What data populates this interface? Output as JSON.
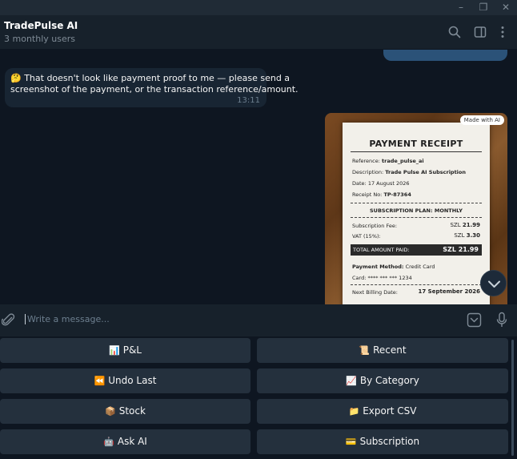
{
  "window": {
    "min_icon": "minimize-icon",
    "max_icon": "restore-icon",
    "close_icon": "close-icon"
  },
  "header": {
    "title": "TradePulse AI",
    "subtitle": "3 monthly users",
    "icons": [
      "search-icon",
      "sidebar-toggle-icon",
      "more-vert-icon"
    ]
  },
  "messages": {
    "incoming": {
      "emoji": "🤔",
      "line1": "That doesn't look like payment proof to me — please send a",
      "line2": "screenshot of the payment, or the transaction reference/amount.",
      "time": "13:11"
    },
    "image": {
      "badge": "Made with AI",
      "receipt": {
        "title": "PAYMENT RECEIPT",
        "reference_label": "Reference:",
        "reference": "trade_pulse_ai",
        "description_label": "Description:",
        "description": "Trade Pulse AI Subscription",
        "date_label": "Date:",
        "date": "17 August 2026",
        "receipt_no_label": "Receipt No:",
        "receipt_no": "TP-87364",
        "plan": "SUBSCRIPTION PLAN: MONTHLY",
        "fee_label": "Subscription Fee:",
        "fee_currency": "SZL",
        "fee": "21.99",
        "vat_label": "VAT (15%):",
        "vat_currency": "SZL",
        "vat": "3.30",
        "total_label": "TOTAL AMOUNT PAID:",
        "total": "SZL 21.99",
        "method_label": "Payment Method:",
        "method": "Credit Card",
        "card_label": "Card:",
        "card": "**** *** *** 1234",
        "next_label": "Next Billing Date:",
        "next": "17 September 2026"
      }
    }
  },
  "composer": {
    "placeholder": "Write a message...",
    "icons": [
      "attach-icon",
      "bot-keyboard-icon",
      "microphone-icon"
    ]
  },
  "keyboard": {
    "buttons": [
      {
        "icon": "📊",
        "label": "P&L"
      },
      {
        "icon": "📜",
        "label": "Recent"
      },
      {
        "icon": "⏪",
        "label": "Undo Last"
      },
      {
        "icon": "📈",
        "label": "By Category"
      },
      {
        "icon": "📦",
        "label": "Stock"
      },
      {
        "icon": "📁",
        "label": "Export CSV"
      },
      {
        "icon": "🤖",
        "label": "Ask AI"
      },
      {
        "icon": "💳",
        "label": "Subscription"
      }
    ]
  },
  "colors": {
    "bg": "#0e1621",
    "panel": "#17212b",
    "incoming_bubble": "#182533",
    "accent": "#2b5278",
    "key": "#24303d"
  }
}
